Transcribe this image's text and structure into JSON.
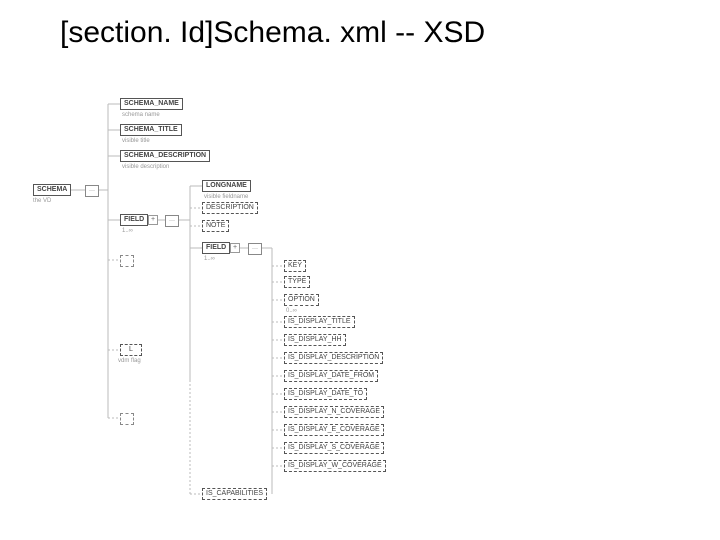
{
  "title": "[section. Id]Schema. xml -- XSD",
  "nodes": {
    "schema": "SCHEMA",
    "schema_cap": "the VD",
    "schema_name": "SCHEMA_NAME",
    "schema_name_cap": "schema name",
    "schema_title": "SCHEMA_TITLE",
    "schema_title_cap": "visible title",
    "schema_description": "SCHEMA_DESCRIPTION",
    "schema_description_cap": "visible description",
    "field1": "FIELD",
    "field1_rep": "1..∞",
    "longname": "LONGNAME",
    "longname_cap": "visible fieldname",
    "description": "DESCRIPTION",
    "note": "NOTE",
    "field2": "FIELD",
    "field2_rep": "1..∞",
    "key": "KEY",
    "type": "TYPE",
    "option": "OPTION",
    "option_rep": "0..∞",
    "is_display_title": "IS_DISPLAY_TITLE",
    "is_display_hh": "IS_DISPLAY_HH",
    "is_display_description": "IS_DISPLAY_DESCRIPTION",
    "is_display_date_from": "IS_DISPLAY_DATE_FROM",
    "is_display_date_to": "IS_DISPLAY_DATE_TO",
    "is_display_n_coverage": "IS_DISPLAY_N_COVERAGE",
    "is_display_e_coverage": "IS_DISPLAY_E_COVERAGE",
    "is_display_s_coverage": "IS_DISPLAY_S_COVERAGE",
    "is_display_w_coverage": "IS_DISPLAY_W_COVERAGE",
    "is_capabilities": "IS_CAPABILITIES",
    "lang": "L",
    "lang_cap": "vdm flag"
  }
}
